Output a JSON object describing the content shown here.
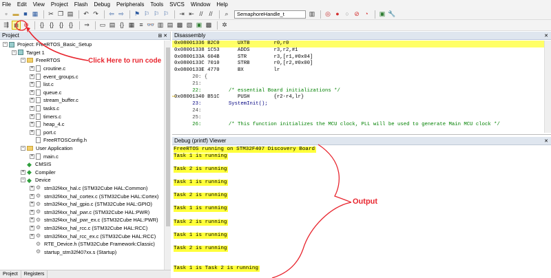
{
  "menu": [
    "File",
    "Edit",
    "View",
    "Project",
    "Flash",
    "Debug",
    "Peripherals",
    "Tools",
    "SVCS",
    "Window",
    "Help"
  ],
  "toolbar": {
    "combo_value": "SemaphoreHandle_t"
  },
  "project_panel": {
    "title": "Project",
    "items": [
      {
        "label": "Project: FreeRTOS_Basic_Setup",
        "level": 0,
        "icon": "project-icon",
        "expand": "−"
      },
      {
        "label": "Target 1",
        "level": 1,
        "icon": "target-icon",
        "expand": "−"
      },
      {
        "label": "FreeRTOS",
        "level": 2,
        "icon": "folder-icon",
        "expand": "−"
      },
      {
        "label": "croutine.c",
        "level": 3,
        "icon": "file-icon",
        "expand": "+"
      },
      {
        "label": "event_groups.c",
        "level": 3,
        "icon": "file-icon",
        "expand": "+"
      },
      {
        "label": "list.c",
        "level": 3,
        "icon": "file-icon",
        "expand": "+"
      },
      {
        "label": "queue.c",
        "level": 3,
        "icon": "file-icon",
        "expand": "+"
      },
      {
        "label": "stream_buffer.c",
        "level": 3,
        "icon": "file-icon",
        "expand": "+"
      },
      {
        "label": "tasks.c",
        "level": 3,
        "icon": "file-icon",
        "expand": "+"
      },
      {
        "label": "timers.c",
        "level": 3,
        "icon": "file-icon",
        "expand": "+"
      },
      {
        "label": "heap_4.c",
        "level": 3,
        "icon": "file-icon",
        "expand": "+"
      },
      {
        "label": "port.c",
        "level": 3,
        "icon": "file-icon",
        "expand": "+"
      },
      {
        "label": "FreeRTOSConfig.h",
        "level": 3,
        "icon": "file-icon",
        "expand": ""
      },
      {
        "label": "User Application",
        "level": 2,
        "icon": "folder-icon",
        "expand": "−"
      },
      {
        "label": "main.c",
        "level": 3,
        "icon": "file-icon",
        "expand": "+"
      },
      {
        "label": "CMSIS",
        "level": 2,
        "icon": "diamond-icon",
        "expand": ""
      },
      {
        "label": "Compiler",
        "level": 2,
        "icon": "diamond-icon",
        "expand": "+"
      },
      {
        "label": "Device",
        "level": 2,
        "icon": "diamond-icon",
        "expand": "−"
      },
      {
        "label": "stm32f4xx_hal.c (STM32Cube HAL:Common)",
        "level": 3,
        "icon": "gear-icon",
        "expand": "+"
      },
      {
        "label": "stm32f4xx_hal_cortex.c (STM32Cube HAL:Cortex)",
        "level": 3,
        "icon": "gear-icon",
        "expand": "+"
      },
      {
        "label": "stm32f4xx_hal_gpio.c (STM32Cube HAL:GPIO)",
        "level": 3,
        "icon": "gear-icon",
        "expand": "+"
      },
      {
        "label": "stm32f4xx_hal_pwr.c (STM32Cube HAL:PWR)",
        "level": 3,
        "icon": "gear-icon",
        "expand": "+"
      },
      {
        "label": "stm32f4xx_hal_pwr_ex.c (STM32Cube HAL:PWR)",
        "level": 3,
        "icon": "gear-icon",
        "expand": "+"
      },
      {
        "label": "stm32f4xx_hal_rcc.c (STM32Cube HAL:RCC)",
        "level": 3,
        "icon": "gear-icon",
        "expand": "+"
      },
      {
        "label": "stm32f4xx_hal_rcc_ex.c (STM32Cube HAL:RCC)",
        "level": 3,
        "icon": "gear-icon",
        "expand": "+"
      },
      {
        "label": "RTE_Device.h (STM32Cube Framework:Classic)",
        "level": 3,
        "icon": "gear-icon",
        "expand": ""
      },
      {
        "label": "startup_stm32f407xx.s (Startup)",
        "level": 3,
        "icon": "gear-icon",
        "expand": ""
      }
    ],
    "tabs": [
      "Project",
      "Registers"
    ]
  },
  "annotations": {
    "run_hint": "Click Here to run code",
    "output_label": "Output"
  },
  "disassembly": {
    "title": "Disassembly",
    "lines": [
      {
        "text": "0x08001336 B2C0      UXTB        r0,r0",
        "kind": "addr",
        "hl": true
      },
      {
        "text": "0x08001338 1C53      ADDS        r3,r2,#1",
        "kind": "addr",
        "hl": false
      },
      {
        "text": "0x0800133A 604B      STR         r3,[r1,#0x04]",
        "kind": "addr",
        "hl": false
      },
      {
        "text": "0x0800133C 7010      STRB        r0,[r2,#0x00]",
        "kind": "addr",
        "hl": false
      },
      {
        "text": "0x0800133E 4770      BX          lr",
        "kind": "addr",
        "hl": false
      },
      {
        "text": "      20: {",
        "kind": "lnum",
        "hl": false
      },
      {
        "text": "      21:",
        "kind": "lnum",
        "hl": false
      },
      {
        "text": "      22:         /* essential Board initializations */",
        "kind": "comment",
        "hl": false
      },
      {
        "text": "0x08001340 B51C      PUSH        {r2-r4,lr}",
        "kind": "addr",
        "hl": false,
        "arrow": true
      },
      {
        "text": "      23:         SystemInit();",
        "kind": "src",
        "hl": false
      },
      {
        "text": "      24:",
        "kind": "lnum",
        "hl": false
      },
      {
        "text": "      25:",
        "kind": "lnum",
        "hl": false
      },
      {
        "text": "      26:         /* This function initializes the MCU clock, PLL will be used to generate Main MCU clock */",
        "kind": "comment",
        "hl": false
      }
    ]
  },
  "debug_viewer": {
    "title": "Debug (printf) Viewer",
    "lines": [
      {
        "text": "FreeRTOS running on STM32F407 Discovery Board",
        "row": 0
      },
      {
        "text": "Task 1 is running",
        "row": 1
      },
      {
        "text": "Task 2 is running",
        "row": 3
      },
      {
        "text": "Task 1 is running",
        "row": 5
      },
      {
        "text": "Task 2 is running",
        "row": 7
      },
      {
        "text": "Task 1 is running",
        "row": 9
      },
      {
        "text": "Task 2 is running",
        "row": 11
      },
      {
        "text": "Task 1 is running",
        "row": 13
      },
      {
        "text": "Task 2 is running",
        "row": 15
      },
      {
        "text": "Task 1 is Task 2 is running",
        "row": 18
      }
    ]
  }
}
